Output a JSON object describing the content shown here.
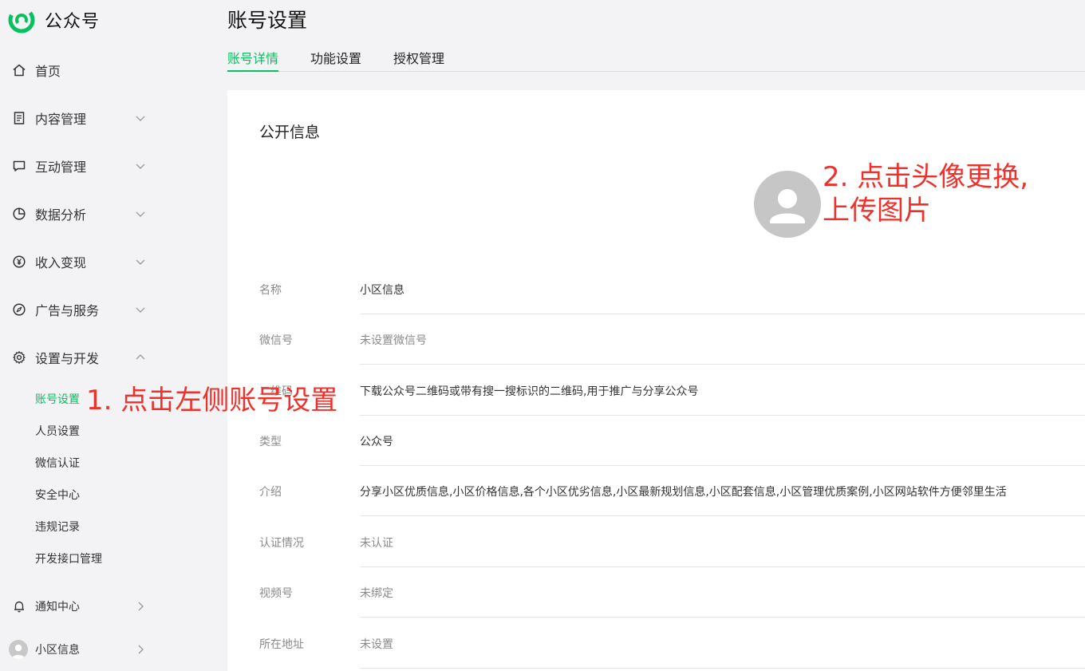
{
  "brand": {
    "name": "公众号",
    "logo_icon": "wechat-official-account-logo",
    "accent": "#07c160"
  },
  "sidebar": {
    "items": [
      {
        "label": "首页",
        "icon": "home-icon"
      },
      {
        "label": "内容管理",
        "icon": "document-icon"
      },
      {
        "label": "互动管理",
        "icon": "chat-bubble-icon"
      },
      {
        "label": "数据分析",
        "icon": "pie-chart-icon"
      },
      {
        "label": "收入变现",
        "icon": "yen-circle-icon"
      },
      {
        "label": "广告与服务",
        "icon": "compass-icon"
      },
      {
        "label": "设置与开发",
        "icon": "gear-icon",
        "expanded": true
      }
    ],
    "sub_items": [
      "账号设置",
      "人员设置",
      "微信认证",
      "安全中心",
      "违规记录",
      "开发接口管理"
    ],
    "notify_label": "通知中心",
    "account_label": "小区信息"
  },
  "annotations": {
    "step1": "1. 点击左侧账号设置",
    "step2_line1": "2. 点击头像更换,",
    "step2_line2": "上传图片",
    "color": "#f0302a"
  },
  "main": {
    "title": "账号设置",
    "tabs": [
      "账号详情",
      "功能设置",
      "授权管理"
    ],
    "active_tab": "账号详情",
    "section_title": "公开信息",
    "rows": [
      {
        "key": "名称",
        "value": "小区信息"
      },
      {
        "key": "微信号",
        "value": "未设置微信号"
      },
      {
        "key": "二维码",
        "value": "下载公众号二维码或带有搜一搜标识的二维码,用于推广与分享公众号"
      },
      {
        "key": "类型",
        "value": "公众号"
      },
      {
        "key": "介绍",
        "value": "分享小区优质信息,小区价格信息,各个小区优劣信息,小区最新规划信息,小区配套信息,小区管理优质案例,小区网站软件方便邻里生活"
      },
      {
        "key": "认证情况",
        "value": "未认证"
      },
      {
        "key": "视频号",
        "value": "未绑定"
      },
      {
        "key": "所在地址",
        "value": "未设置"
      }
    ]
  }
}
